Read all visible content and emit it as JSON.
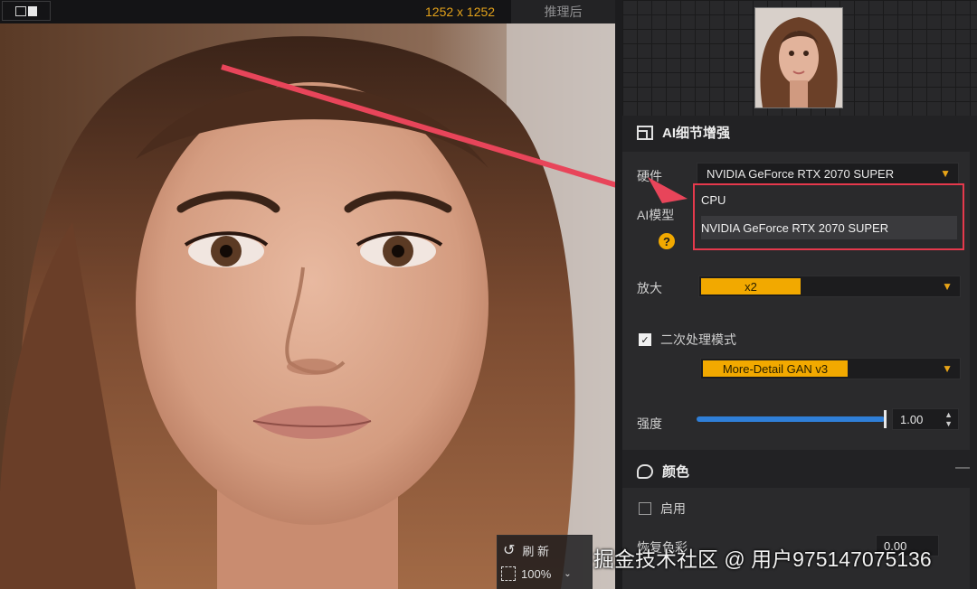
{
  "toolbar": {
    "dimensions": "1252 x 1252",
    "after_tab": "推理后"
  },
  "canvas": {
    "refresh_label": "刷 新",
    "zoom_value": "100%"
  },
  "panel": {
    "enhance_title": "AI细节增强",
    "hardware_label": "硬件",
    "hardware_value": "NVIDIA GeForce RTX 2070 SUPER",
    "model_label": "AI模型",
    "dropdown_options": [
      "CPU",
      "NVIDIA GeForce RTX 2070 SUPER"
    ],
    "help_icon_glyph": "?",
    "scale_label": "放大",
    "scale_value": "x2",
    "second_pass_label": "二次处理模式",
    "second_pass_checked": true,
    "second_pass_model": "More-Detail GAN  v3",
    "strength_label": "强度",
    "strength_value": "1.00",
    "strength_fraction": 1.0,
    "color_title": "颜色",
    "color_collapse": "—",
    "enable_label": "启用",
    "enable_checked": false,
    "restore_label": "恢复色彩",
    "restore_value": "0.00"
  },
  "watermark": "掘金技术社区 @ 用户975147075136",
  "colors": {
    "accent": "#f2a900",
    "highlight_box": "#e5394c",
    "slider": "#2f7fd8"
  }
}
